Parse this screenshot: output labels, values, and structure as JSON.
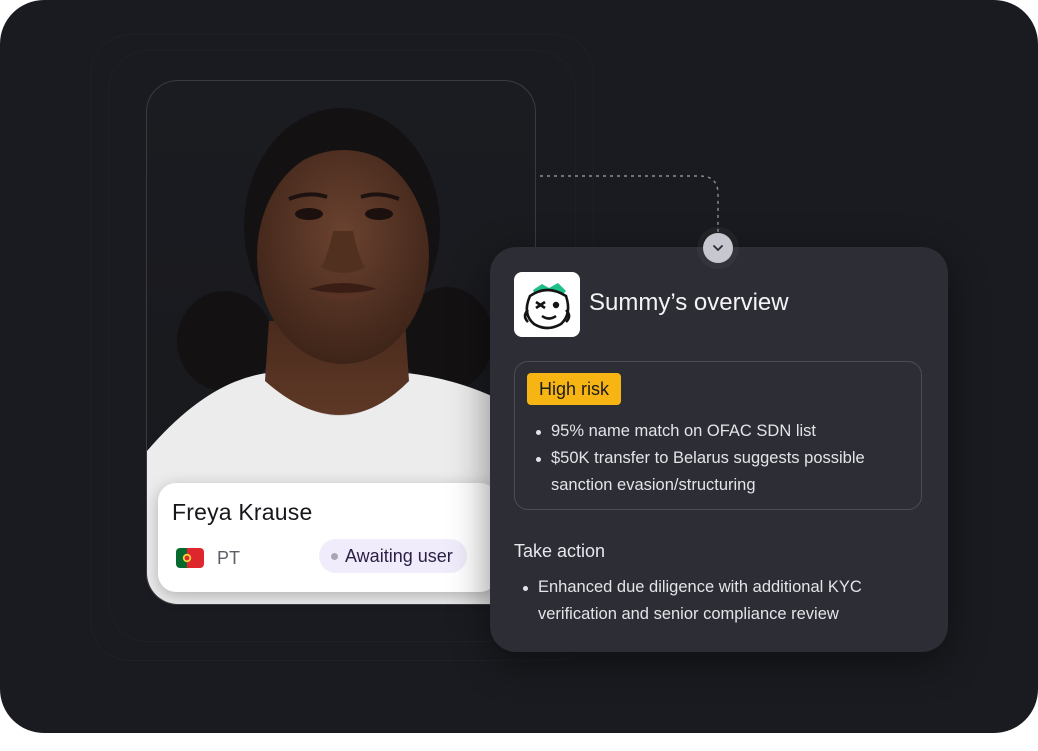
{
  "profile": {
    "name": "Freya Krause",
    "country_code": "PT",
    "flag_icon": "portugal-flag-icon",
    "status": "Awaiting user"
  },
  "overview": {
    "title": "Summy’s overview",
    "logo_icon": "summy-mascot-icon",
    "connector_icon": "chevron-down-icon",
    "risk_label": "High risk",
    "risk_color": "#F7B514",
    "findings": [
      "95% name match on OFAC SDN list",
      "$50K transfer to Belarus suggests possible sanction evasion/structuring"
    ],
    "action_title": "Take action",
    "actions": [
      "Enhanced due diligence with additional KYC verification and senior compliance review"
    ]
  },
  "colors": {
    "background": "#1A1B20",
    "card": "#2C2D35",
    "status_badge": "#F1ECFB"
  }
}
